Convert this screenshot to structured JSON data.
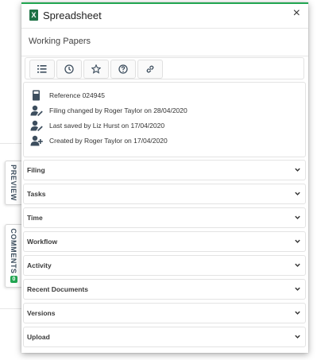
{
  "header": {
    "app_icon": "spreadsheet-x-icon",
    "app_icon_glyph": "X",
    "title": "Spreadsheet",
    "close_glyph": "×"
  },
  "subtitle": "Working Papers",
  "toolbar": {
    "buttons": [
      {
        "icon": "list-icon"
      },
      {
        "icon": "clock-icon"
      },
      {
        "icon": "star-icon"
      },
      {
        "icon": "help-icon"
      },
      {
        "icon": "link-icon"
      }
    ]
  },
  "info": {
    "reference": "Reference 024945",
    "filing_changed": "Filing changed by Roger Taylor on 28/04/2020",
    "last_saved": "Last saved by Liz Hurst on 17/04/2020",
    "created": "Created by Roger Taylor on 17/04/2020"
  },
  "sections": [
    {
      "label": "Filing"
    },
    {
      "label": "Tasks"
    },
    {
      "label": "Time"
    },
    {
      "label": "Workflow"
    },
    {
      "label": "Activity"
    },
    {
      "label": "Recent Documents"
    },
    {
      "label": "Versions"
    },
    {
      "label": "Upload"
    }
  ],
  "side_tabs": {
    "preview": "PREVIEW",
    "comments": "COMMENTS",
    "comments_badge": "0"
  },
  "colors": {
    "accent": "#22a652",
    "excel_green": "#1e7145",
    "icon_dark": "#3d4e5e"
  }
}
